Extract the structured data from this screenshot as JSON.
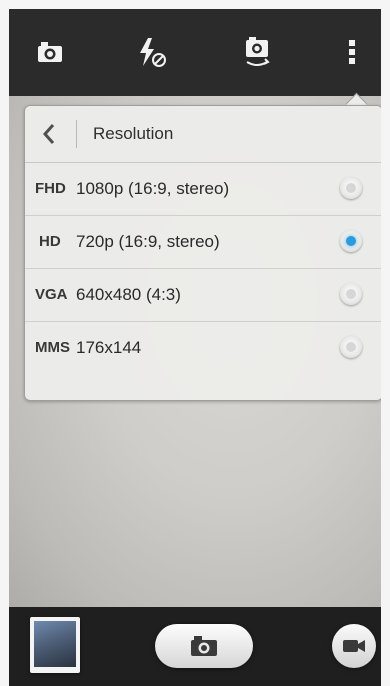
{
  "top_bar": {
    "icons": [
      "camera-switch-icon",
      "flash-off-icon",
      "camera-rotate-icon",
      "overflow-menu-icon"
    ]
  },
  "resolution_popup": {
    "title": "Resolution",
    "options": [
      {
        "tag": "FHD",
        "label": "1080p (16:9, stereo)",
        "selected": false
      },
      {
        "tag": "HD",
        "label": "720p (16:9, stereo)",
        "selected": true
      },
      {
        "tag": "VGA",
        "label": "640x480 (4:3)",
        "selected": false
      },
      {
        "tag": "MMS",
        "label": "176x144",
        "selected": false
      }
    ]
  },
  "bottom_bar": {
    "icons": [
      "gallery-thumbnail",
      "camera-shutter-icon",
      "video-record-icon"
    ]
  },
  "colors": {
    "accent": "#2d9bdb",
    "top_bar": "#2b2b2b",
    "bottom_bar": "#1f1f1f"
  }
}
